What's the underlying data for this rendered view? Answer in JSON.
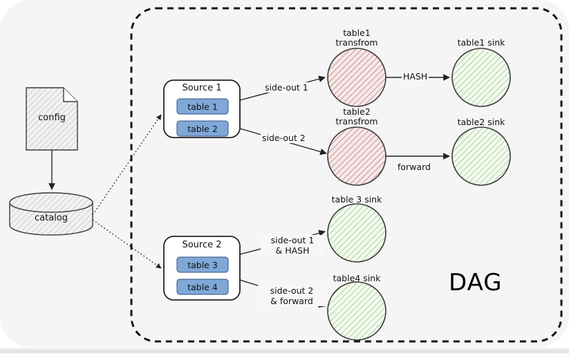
{
  "diagram": {
    "title": "DAG",
    "background_color": "#f5f5f5",
    "boundary": {
      "name": "DAG boundary",
      "style": "dashed"
    },
    "colors": {
      "table_chip": "#7fa8d8",
      "transform_fill": "#e9d3d3",
      "transform_hatch": "#c58a8a",
      "sink_fill": "#eaf4e3",
      "sink_hatch": "#a8cf96",
      "stroke": "#3a3a3a",
      "hatch_gray": "#bdbdbd"
    },
    "external_nodes": [
      {
        "id": "config",
        "label": "config",
        "shape": "document"
      },
      {
        "id": "catalog",
        "label": "catalog",
        "shape": "cylinder"
      }
    ],
    "sources": [
      {
        "id": "source1",
        "label": "Source 1",
        "tables": [
          {
            "label": "table 1"
          },
          {
            "label": "table 2"
          }
        ]
      },
      {
        "id": "source2",
        "label": "Source 2",
        "tables": [
          {
            "label": "table 3"
          },
          {
            "label": "table 4"
          }
        ]
      }
    ],
    "transforms": [
      {
        "id": "t1",
        "label_line1": "table1",
        "label_line2": "transfrom"
      },
      {
        "id": "t2",
        "label_line1": "table2",
        "label_line2": "transfrom"
      }
    ],
    "sinks": [
      {
        "id": "sink1",
        "label": "table1 sink"
      },
      {
        "id": "sink2",
        "label": "table2 sink"
      },
      {
        "id": "sink3",
        "label": "table 3 sink"
      },
      {
        "id": "sink4",
        "label": "table4 sink"
      }
    ],
    "edges": [
      {
        "id": "e_config_catalog",
        "label": "",
        "from": "config",
        "to": "catalog",
        "style": "solid"
      },
      {
        "id": "e_catalog_s1",
        "label": "",
        "from": "catalog",
        "to": "source1",
        "style": "dotted"
      },
      {
        "id": "e_catalog_s2",
        "label": "",
        "from": "catalog",
        "to": "source2",
        "style": "dotted"
      },
      {
        "id": "e_s1_t1",
        "label": "side-out 1",
        "from": "source1",
        "to": "t1",
        "style": "solid"
      },
      {
        "id": "e_s1_t2",
        "label": "side-out 2",
        "from": "source1",
        "to": "t2",
        "style": "solid"
      },
      {
        "id": "e_t1_sink1",
        "label": "HASH",
        "from": "t1",
        "to": "sink1",
        "style": "solid"
      },
      {
        "id": "e_t2_sink2",
        "label": "forward",
        "from": "t2",
        "to": "sink2",
        "style": "solid"
      },
      {
        "id": "e_s2_sink3",
        "label_line1": "side-out 1",
        "label_line2": "& HASH",
        "from": "source2",
        "to": "sink3",
        "style": "solid"
      },
      {
        "id": "e_s2_sink4",
        "label_line1": "side-out 2",
        "label_line2": "& forward",
        "from": "source2",
        "to": "sink4",
        "style": "solid"
      }
    ]
  }
}
